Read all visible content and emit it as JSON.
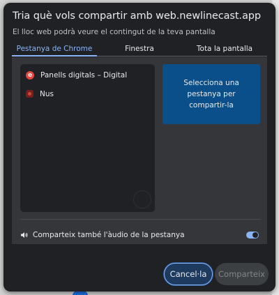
{
  "dialog": {
    "title": "Tria què vols compartir amb web.newlinecast.app",
    "subtitle": "El lloc web podrà veure el contingut de la teva pantalla"
  },
  "tabs": [
    {
      "label": "Pestanya de Chrome",
      "active": true
    },
    {
      "label": "Finestra",
      "active": false
    },
    {
      "label": "Tota la pantalla",
      "active": false
    }
  ],
  "tab_list": [
    {
      "title": "Panells digitals – Digital",
      "icon": "e-favicon",
      "icon_letter": "e"
    },
    {
      "title": "Nus",
      "icon": "nus-favicon"
    }
  ],
  "preview": {
    "text": "Selecciona una pestanya per compartir-la"
  },
  "audio": {
    "label": "Comparteix també l'àudio de la pestanya",
    "enabled": true
  },
  "buttons": {
    "cancel": "Cancel·la",
    "share": "Comparteix"
  },
  "colors": {
    "dialog_bg": "#202124",
    "accent": "#8ab4f8",
    "preview_bg": "#0b4f8a",
    "favicon_e": "#e8453c"
  }
}
